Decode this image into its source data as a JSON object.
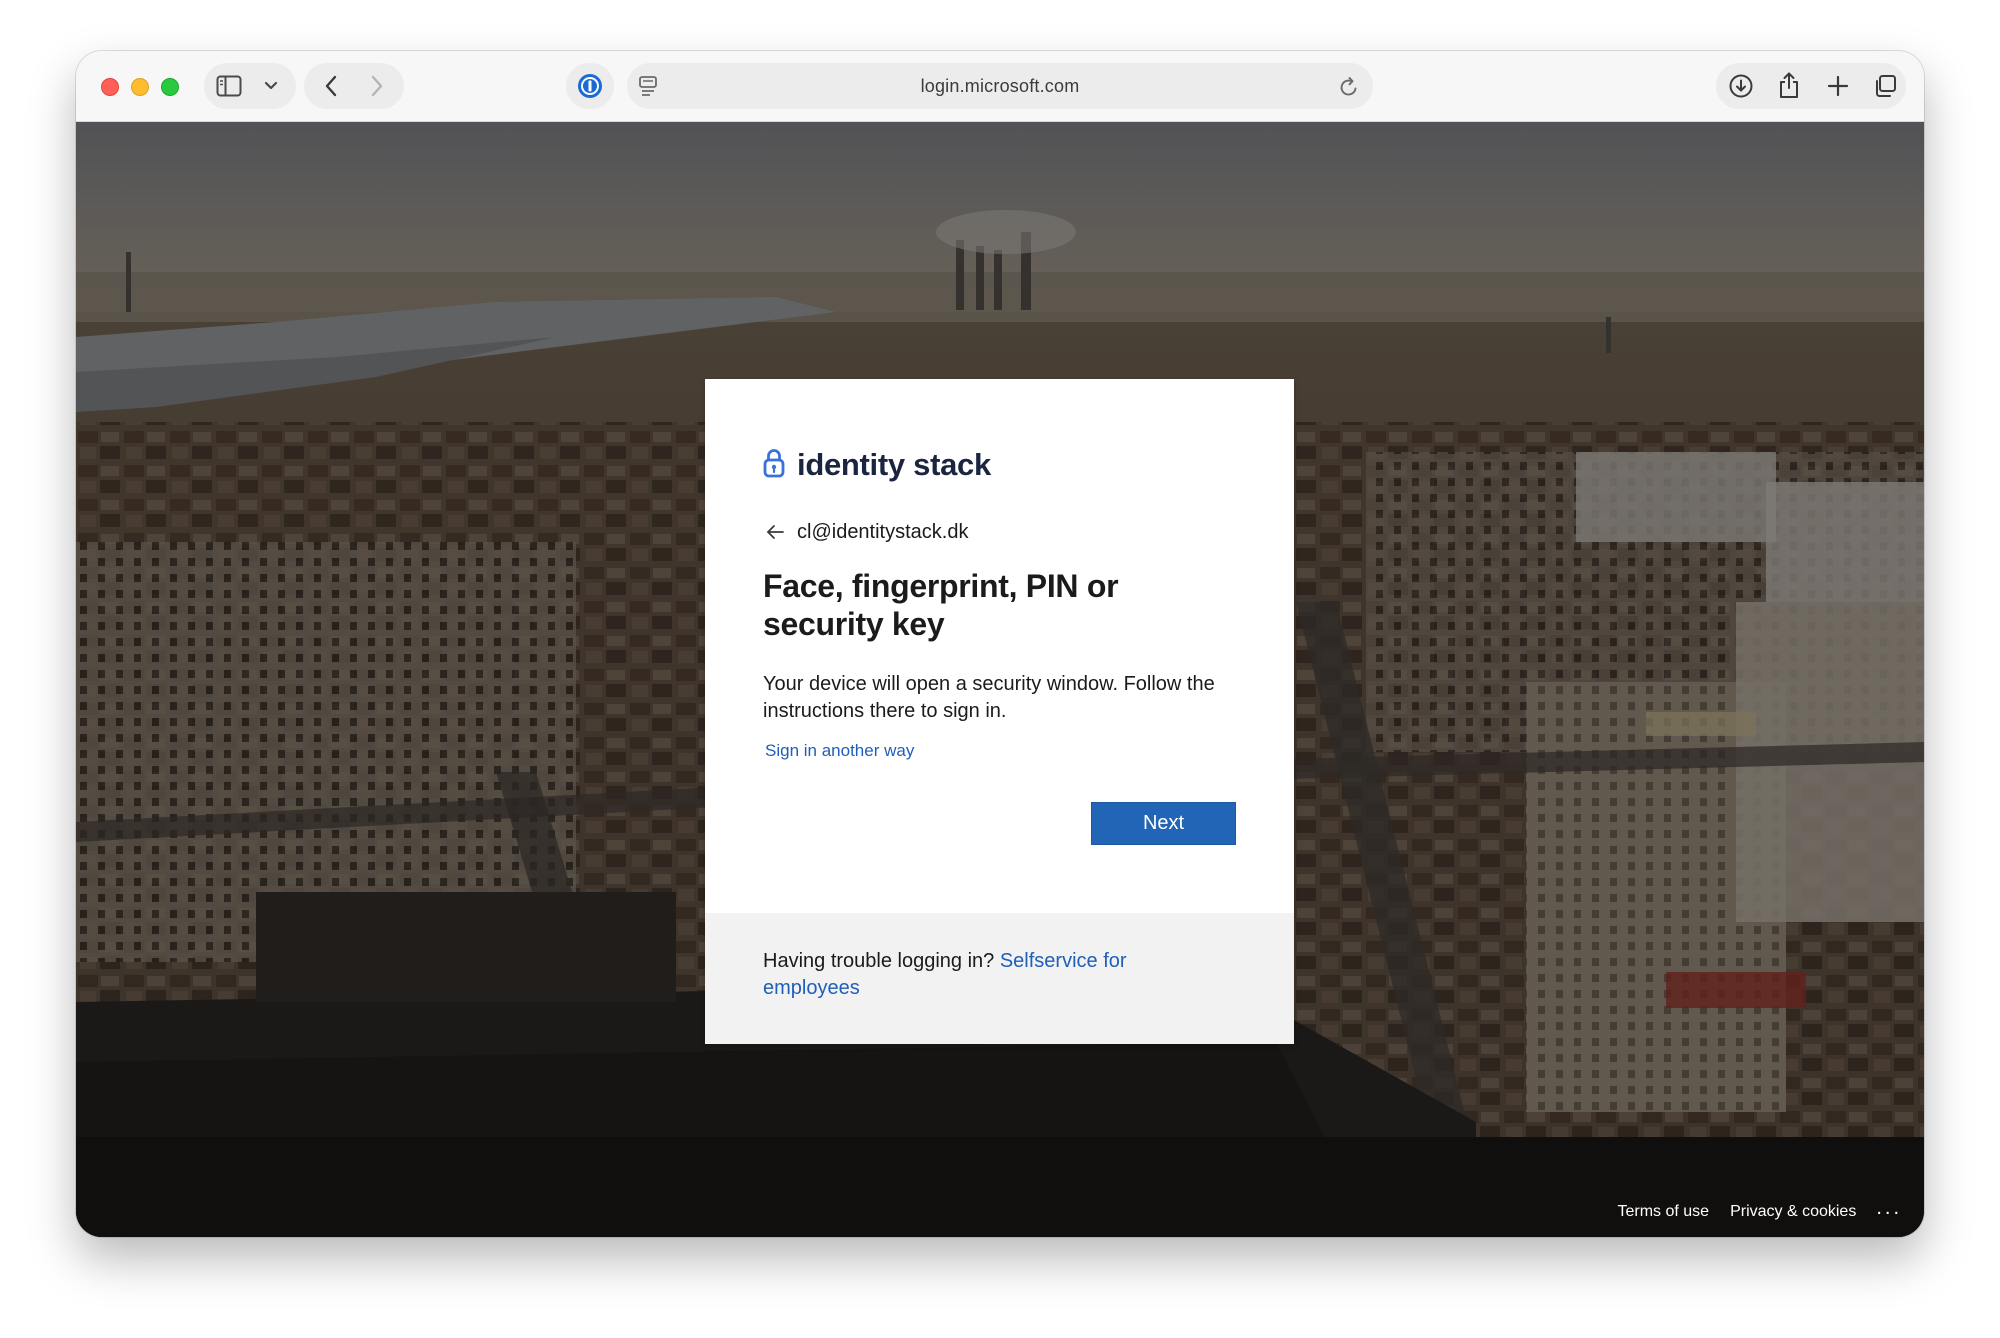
{
  "browser": {
    "url": "login.microsoft.com"
  },
  "signin": {
    "brand": "identity stack",
    "identity": "cl@identitystack.dk",
    "title": "Face, fingerprint, PIN or security key",
    "description": "Your device will open a security window. Follow the instructions there to sign in.",
    "alt_link": "Sign in another way",
    "next_label": "Next",
    "footer_text": "Having trouble logging in?",
    "footer_link": "Selfservice for employees"
  },
  "page_footer": {
    "terms": "Terms of use",
    "privacy": "Privacy & cookies",
    "more": "..."
  },
  "colors": {
    "primary_button": "#2265b6",
    "link": "#1f5fb8",
    "brand_text": "#1b2541",
    "brand_icon": "#3a72d8"
  },
  "icons": {
    "sidebar": "sidebar-toggle-icon",
    "back": "chevron-left-icon",
    "forward": "chevron-right-icon",
    "password_manager": "password-manager-icon",
    "reader": "reader-icon",
    "reload": "reload-icon",
    "download": "download-icon",
    "share": "share-icon",
    "new_tab": "plus-icon",
    "tabs": "tab-overview-icon",
    "brand": "padlock-icon",
    "identity_back": "arrow-left-icon"
  }
}
